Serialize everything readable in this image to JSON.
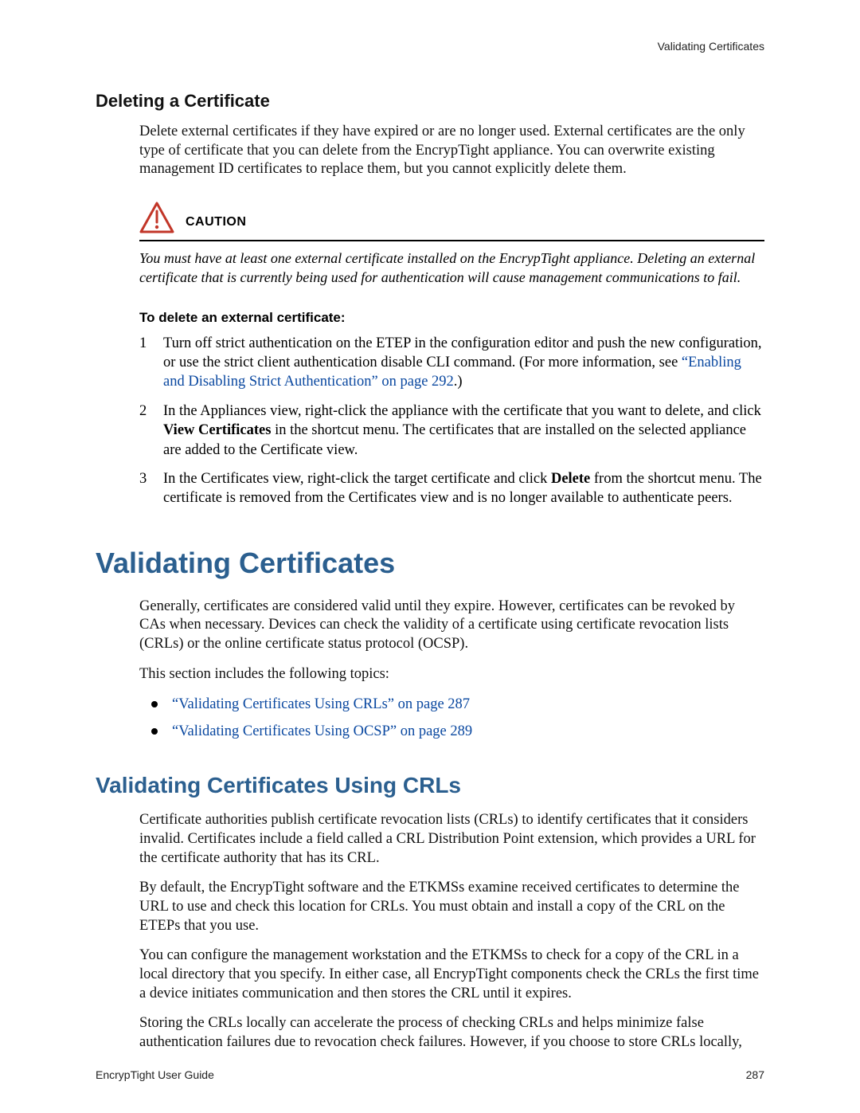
{
  "running_head": "Validating Certificates",
  "section_delete": {
    "heading": "Deleting a Certificate",
    "para": "Delete external certificates if they have expired or are no longer used. External certificates are the only type of certificate that you can delete from the EncrypTight appliance. You can overwrite existing management ID certificates to replace them, but you cannot explicitly delete them."
  },
  "caution": {
    "label": "CAUTION",
    "text": "You must have at least one external certificate installed on the EncrypTight appliance. Deleting an external certificate that is currently being used for authentication will cause management communications to fail."
  },
  "task": {
    "heading": "To delete an external certificate:",
    "steps": {
      "s1_pre": "Turn off strict authentication on the ETEP in the configuration editor and push the new configuration, or use the strict client authentication disable CLI command. (For more information, see ",
      "s1_link": "“Enabling and Disabling Strict Authentication” on page 292",
      "s1_post": ".)",
      "s2_pre": "In the Appliances view, right-click the appliance with the certificate that you want to delete, and click ",
      "s2_bold": "View Certificates",
      "s2_post": " in the shortcut menu. The certificates that are installed on the selected appliance are added to the Certificate view.",
      "s3_pre": "In the Certificates view, right-click the target certificate and click ",
      "s3_bold": "Delete",
      "s3_post": " from the shortcut menu. The certificate is removed from the Certificates view and is no longer available to authenticate peers."
    }
  },
  "validating": {
    "h1": "Validating Certificates",
    "p1": "Generally, certificates are considered valid until they expire. However, certificates can be revoked by CAs when necessary. Devices can check the validity of a certificate using certificate revocation lists (CRLs) or the online certificate status protocol (OCSP).",
    "p2": "This section includes the following topics:",
    "links": {
      "crl": "“Validating Certificates Using CRLs” on page 287",
      "ocsp": "“Validating Certificates Using OCSP” on page 289"
    }
  },
  "crls": {
    "h2": "Validating Certificates Using CRLs",
    "p1": "Certificate authorities publish certificate revocation lists (CRLs) to identify certificates that it considers invalid. Certificates include a field called a CRL Distribution Point extension, which provides a URL for the certificate authority that has its CRL.",
    "p2": "By default, the EncrypTight software and the ETKMSs examine received certificates to determine the URL to use and check this location for CRLs. You must obtain and install a copy of the CRL on the ETEPs that you use.",
    "p3": "You can configure the management workstation and the ETKMSs to check for a copy of the CRL in a local directory that you specify. In either case, all EncrypTight components check the CRLs the first time a device initiates communication and then stores the CRL until it expires.",
    "p4": "Storing the CRLs locally can accelerate the process of checking CRLs and helps minimize false authentication failures due to revocation check failures. However, if you choose to store CRLs locally,"
  },
  "footer": {
    "left": "EncrypTight User Guide",
    "right": "287"
  }
}
